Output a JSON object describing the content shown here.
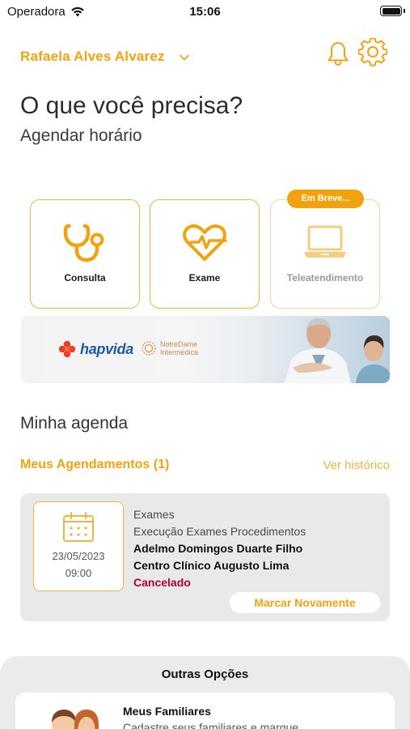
{
  "status_bar": {
    "carrier": "Operadora",
    "time": "15:06"
  },
  "header": {
    "user_name": "Rafaela Alves Alvarez"
  },
  "hero": {
    "title": "O que você precisa?",
    "subtitle": "Agendar horário"
  },
  "services": [
    {
      "label": "Consulta",
      "icon": "stethoscope-icon"
    },
    {
      "label": "Exame",
      "icon": "heart-pulse-icon"
    },
    {
      "label": "Teleatendimento",
      "icon": "laptop-icon",
      "badge": "Em Breve..."
    }
  ],
  "banner": {
    "brand1": "hapvida",
    "brand2_line1": "NotreDame",
    "brand2_line2": "Intermédica"
  },
  "agenda": {
    "section_title": "Minha agenda",
    "appointments_title": "Meus Agendamentos (1)",
    "history_link": "Ver histórico",
    "appointment": {
      "date": "23/05/2023",
      "time": "09:00",
      "type": "Exames",
      "description": "Execução Exames Procedimentos",
      "doctor": "Adelmo Domingos Duarte Filho",
      "place": "Centro Clínico Augusto Lima",
      "status": "Cancelado",
      "rebook_label": "Marcar Novamente"
    }
  },
  "others": {
    "title": "Outras Opções",
    "family_title": "Meus Familiares",
    "family_subtitle": "Cadastre seus familiares e marque"
  },
  "colors": {
    "accent": "#f2a20c",
    "status_cancelled": "#b00038",
    "brand_blue": "#1c5aa6"
  }
}
